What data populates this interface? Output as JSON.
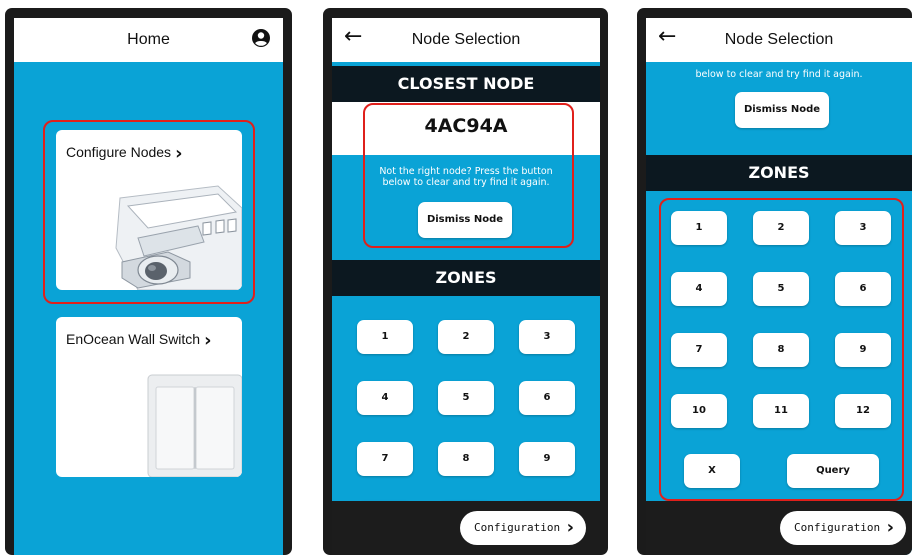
{
  "screen1": {
    "title": "Home",
    "cards": [
      {
        "label": "Configure Nodes"
      },
      {
        "label": "EnOcean Wall Switch"
      }
    ]
  },
  "screen2": {
    "title": "Node Selection",
    "closest_label": "CLOSEST NODE",
    "node_id": "4AC94A",
    "hint_line1": "Not the right node? Press the button",
    "hint_line2": "below to clear and try find it again.",
    "dismiss_label": "Dismiss Node",
    "zones_label": "ZONES",
    "zones": [
      "1",
      "2",
      "3",
      "4",
      "5",
      "6",
      "7",
      "8",
      "9"
    ],
    "config_label": "Configuration"
  },
  "screen3": {
    "title": "Node Selection",
    "hint_line2": "below to clear and try find it again.",
    "dismiss_label": "Dismiss Node",
    "zones_label": "ZONES",
    "zones": [
      "1",
      "2",
      "3",
      "4",
      "5",
      "6",
      "7",
      "8",
      "9",
      "10",
      "11",
      "12"
    ],
    "clear_label": "X",
    "query_label": "Query",
    "config_label": "Configuration"
  },
  "colors": {
    "accent": "#0aa3d6",
    "band": "#0c1820",
    "highlight": "#e0201b"
  },
  "icons": {
    "account": "account-circle-icon",
    "back": "arrow-left-icon",
    "chevron": "chevron-right-icon"
  }
}
